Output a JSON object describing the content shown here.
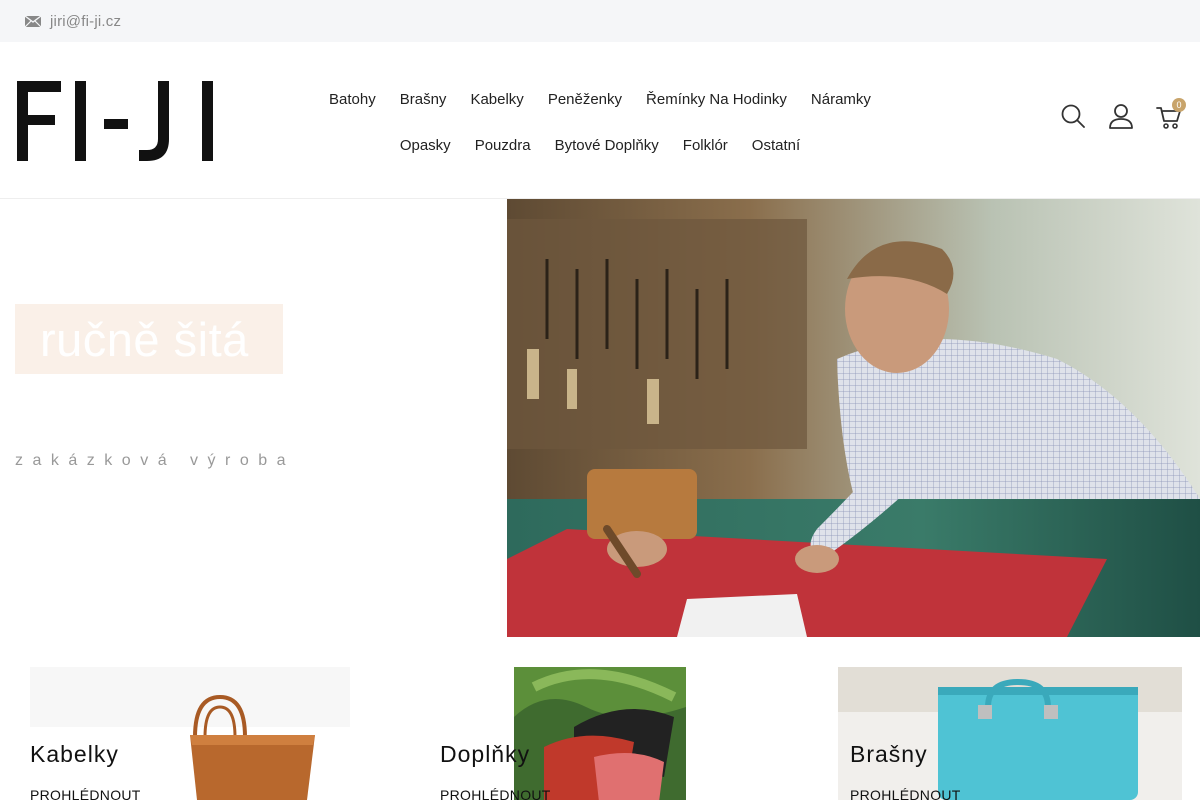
{
  "topbar": {
    "email": "jiri@fi-ji.cz"
  },
  "header": {
    "logo_text": "FI-JI",
    "nav_row1": [
      "Batohy",
      "Brašny",
      "Kabelky",
      "Peněženky",
      "Řemínky Na Hodinky",
      "Náramky"
    ],
    "nav_row2": [
      "Opasky",
      "Pouzdra",
      "Bytové Doplňky",
      "Folklór",
      "Ostatní"
    ],
    "cart_count": "0"
  },
  "hero": {
    "title": "ručně šitá",
    "subtitle": "zakázková výroba"
  },
  "categories": [
    {
      "title": "Kabelky",
      "link": "PROHLÉDNOUT"
    },
    {
      "title": "Doplňky",
      "link": "PROHLÉDNOUT"
    },
    {
      "title": "Brašny",
      "link": "PROHLÉDNOUT"
    }
  ],
  "colors": {
    "accent": "#c8a46b",
    "topbar_bg": "#f5f6f8",
    "title_box": "#faf0e8"
  }
}
